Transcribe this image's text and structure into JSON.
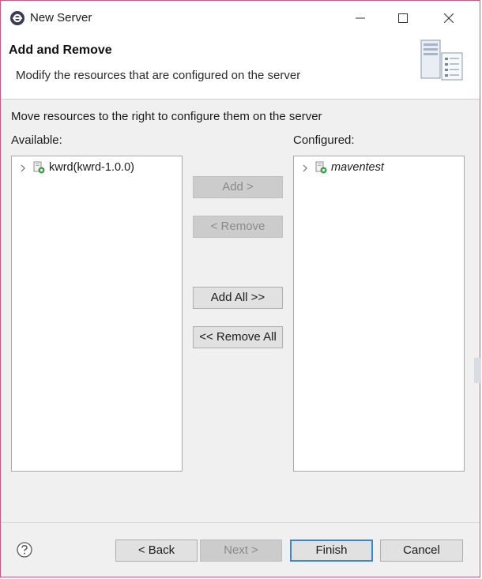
{
  "window": {
    "title": "New Server"
  },
  "header": {
    "title": "Add and Remove",
    "description": "Modify the resources that are configured on the server"
  },
  "body": {
    "instruction": "Move resources to the right to configure them on the server",
    "available_label": "Available:",
    "configured_label": "Configured:",
    "available_items": [
      {
        "label": "kwrd(kwrd-1.0.0)",
        "icon": "web-project-icon"
      }
    ],
    "configured_items": [
      {
        "label": "maventest",
        "icon": "web-project-icon"
      }
    ]
  },
  "buttons": {
    "add": "Add >",
    "remove": "< Remove",
    "add_all": "Add All >>",
    "remove_all": "<< Remove All"
  },
  "footer": {
    "back": "< Back",
    "next": "Next >",
    "finish": "Finish",
    "cancel": "Cancel"
  },
  "colors": {
    "window_border": "#c8577a",
    "default_button_border": "#3a86d6",
    "dialog_background": "#f0f0f0"
  }
}
